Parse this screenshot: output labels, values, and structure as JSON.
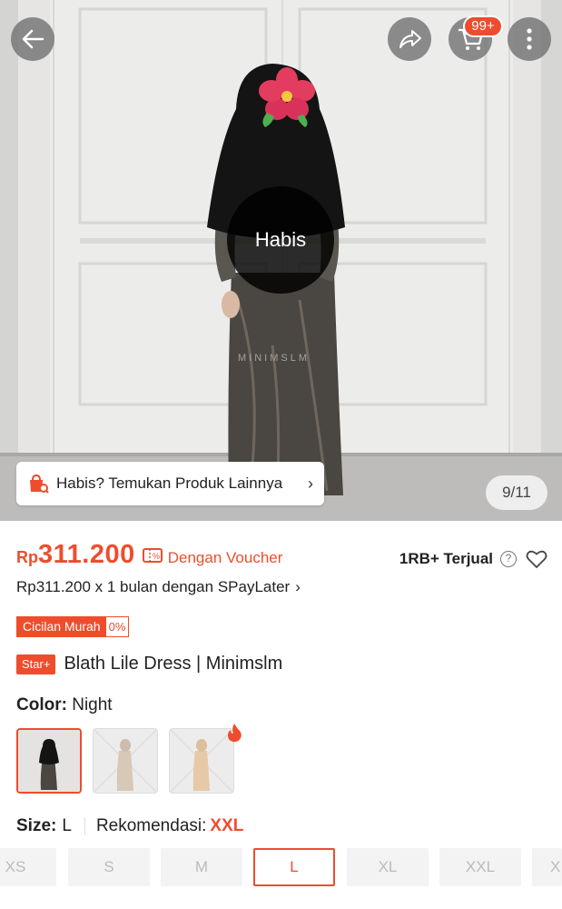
{
  "header": {
    "back_icon": "arrow-left-icon",
    "share_icon": "share-arrow-icon",
    "cart_icon": "cart-icon",
    "cart_badge": "99+",
    "more_icon": "more-vertical-icon"
  },
  "hero": {
    "soldout_label": "Habis",
    "find_other_label": "Habis? Temukan Produk Lainnya",
    "find_other_chevron": "›",
    "image_counter": "9/11",
    "watermark": "MINIMSLM"
  },
  "price": {
    "currency": "Rp",
    "amount": "311.200",
    "voucher_label": "Dengan Voucher",
    "sold": "1RB+ Terjual",
    "help_mark": "?"
  },
  "spaylater": {
    "text": "Rp311.200 x 1 bulan dengan SPayLater",
    "chevron": "›"
  },
  "cicilan": {
    "label": "Cicilan Murah",
    "percent": "0%"
  },
  "product": {
    "badge": "Star+",
    "title": "Blath Lile Dress | Minimslm"
  },
  "variation": {
    "color_label": "Color:",
    "color_value": "Night",
    "size_label": "Size:",
    "size_value": "L",
    "recommend_label": "Rekomendasi:",
    "recommend_value": "XXL",
    "sizes": [
      "XS",
      "S",
      "M",
      "L",
      "XL",
      "XXL",
      "X"
    ],
    "selected_size": "L"
  },
  "colors": {
    "accent": "#ee4d2d"
  }
}
